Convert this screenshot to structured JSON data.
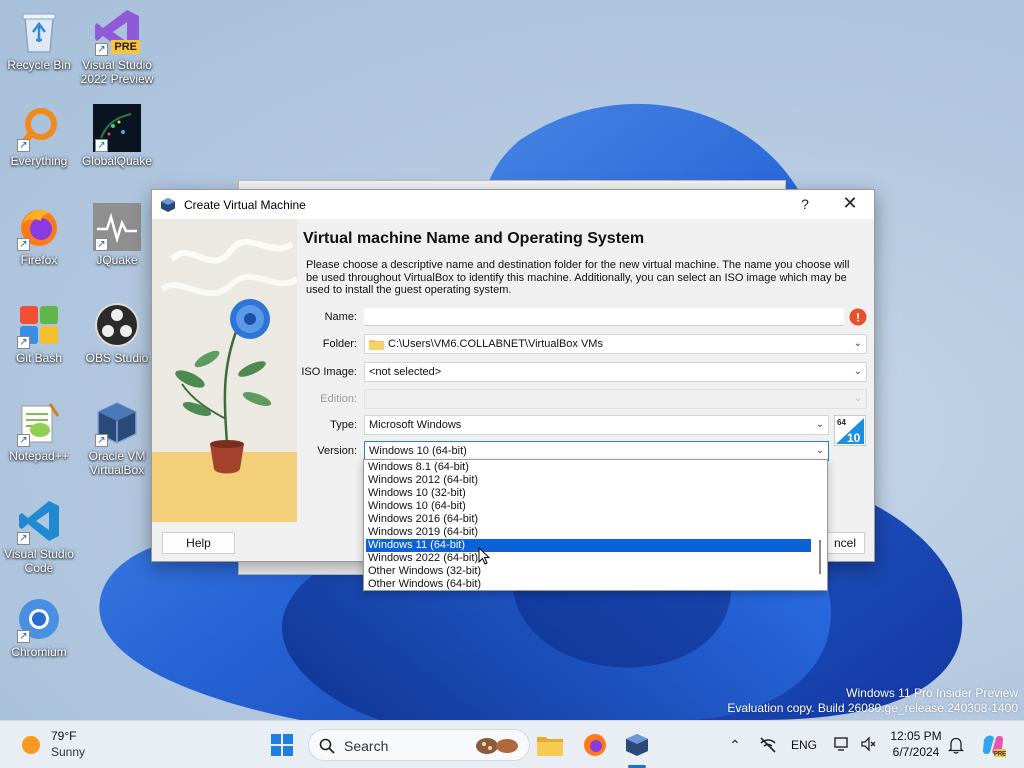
{
  "desktop": {
    "icons": [
      {
        "label": "Recycle Bin"
      },
      {
        "label": "Visual Studio 2022 Preview",
        "badge": "PRE"
      },
      {
        "label": "Everything"
      },
      {
        "label": "GlobalQuake"
      },
      {
        "label": "Firefox"
      },
      {
        "label": "JQuake"
      },
      {
        "label": "Git Bash"
      },
      {
        "label": "OBS Studio"
      },
      {
        "label": "Notepad++"
      },
      {
        "label": "Oracle VM VirtualBox"
      },
      {
        "label": "Visual Studio Code"
      },
      {
        "label": "Chromium"
      }
    ],
    "watermark_line1": "Windows 11 Pro Insider Preview",
    "watermark_line2": "Evaluation copy. Build 26080.ge_release.240308-1400"
  },
  "dialog": {
    "title": "Create Virtual Machine",
    "help_glyph": "?",
    "close_glyph": "✕",
    "heading": "Virtual machine Name and Operating System",
    "description": "Please choose a descriptive name and destination folder for the new virtual machine. The name you choose will be used throughout VirtualBox to identify this machine. Additionally, you can select an ISO image which may be used to install the guest operating system.",
    "fields": {
      "name_label": "Name:",
      "name_value": "",
      "folder_label": "Folder:",
      "folder_value": "C:\\Users\\VM6.COLLABNET\\VirtualBox VMs",
      "iso_label": "ISO Image:",
      "iso_value": "<not selected>",
      "edition_label": "Edition:",
      "edition_value": "",
      "type_label": "Type:",
      "type_value": "Microsoft Windows",
      "version_label": "Version:",
      "version_value": "Windows 10 (64-bit)"
    },
    "os_badge": {
      "top": "64",
      "bottom": "10"
    },
    "help_button": "Help",
    "cancel_button_partial": "ncel",
    "version_options": [
      "Windows 8.1 (64-bit)",
      "Windows 2012 (64-bit)",
      "Windows 10 (32-bit)",
      "Windows 10 (64-bit)",
      "Windows 2016 (64-bit)",
      "Windows 2019 (64-bit)",
      "Windows 11 (64-bit)",
      "Windows 2022 (64-bit)",
      "Other Windows (32-bit)",
      "Other Windows (64-bit)"
    ],
    "highlighted_option": "Windows 11 (64-bit)"
  },
  "taskbar": {
    "weather_temp": "79°F",
    "weather_condition": "Sunny",
    "search_label": "Search",
    "language": "ENG",
    "time": "12:05 PM",
    "date": "6/7/2024"
  },
  "colors": {
    "accent": "#0b61d6",
    "taskbar_bg": "#e9eef5",
    "warning": "#e8502f"
  }
}
